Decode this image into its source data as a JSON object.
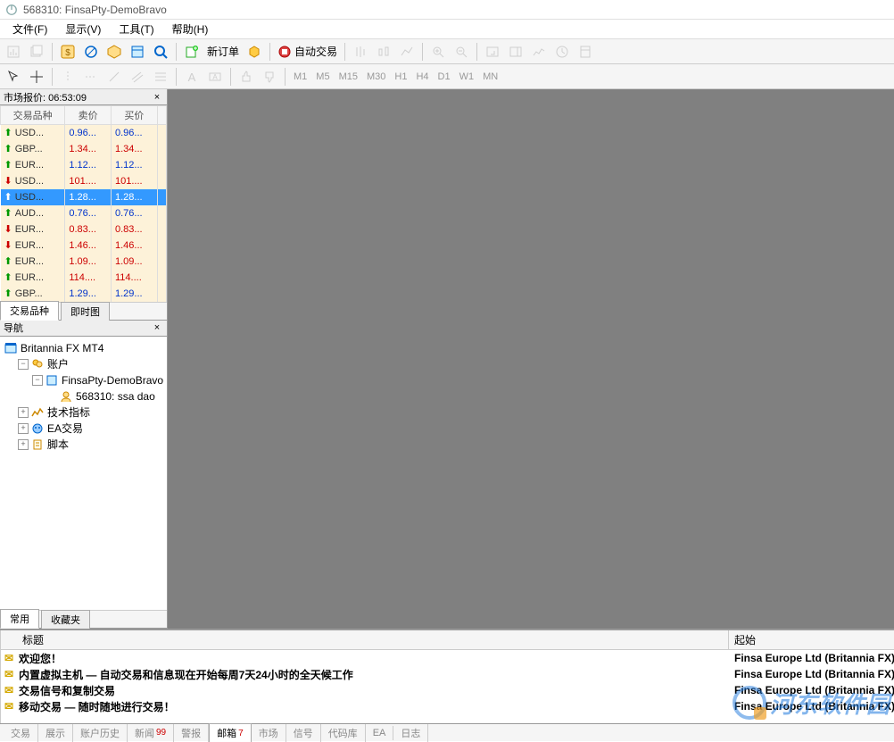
{
  "window": {
    "title": "568310: FinsaPty-DemoBravo"
  },
  "menu": {
    "file": "文件(F)",
    "view": "显示(V)",
    "tools": "工具(T)",
    "help": "帮助(H)"
  },
  "toolbar1": {
    "neworder": "新订单",
    "autotrade": "自动交易"
  },
  "toolbar2": {
    "tf": [
      "M1",
      "M5",
      "M15",
      "M30",
      "H1",
      "H4",
      "D1",
      "W1",
      "MN"
    ]
  },
  "market": {
    "title": "市场报价: 06:53:09",
    "cols": {
      "sym": "交易品种",
      "bid": "卖价",
      "ask": "买价"
    },
    "rows": [
      {
        "dir": "up",
        "sym": "USD...",
        "bid": "0.96...",
        "ask": "0.96...",
        "cls": "up"
      },
      {
        "dir": "up",
        "sym": "GBP...",
        "bid": "1.34...",
        "ask": "1.34...",
        "cls": "dn"
      },
      {
        "dir": "up",
        "sym": "EUR...",
        "bid": "1.12...",
        "ask": "1.12...",
        "cls": "up"
      },
      {
        "dir": "dn",
        "sym": "USD...",
        "bid": "101....",
        "ask": "101....",
        "cls": "dn"
      },
      {
        "dir": "up",
        "sym": "USD...",
        "bid": "1.28...",
        "ask": "1.28...",
        "cls": "up",
        "sel": true
      },
      {
        "dir": "up",
        "sym": "AUD...",
        "bid": "0.76...",
        "ask": "0.76...",
        "cls": "up"
      },
      {
        "dir": "dn",
        "sym": "EUR...",
        "bid": "0.83...",
        "ask": "0.83...",
        "cls": "dn"
      },
      {
        "dir": "dn",
        "sym": "EUR...",
        "bid": "1.46...",
        "ask": "1.46...",
        "cls": "dn"
      },
      {
        "dir": "up",
        "sym": "EUR...",
        "bid": "1.09...",
        "ask": "1.09...",
        "cls": "dn"
      },
      {
        "dir": "up",
        "sym": "EUR...",
        "bid": "114....",
        "ask": "114....",
        "cls": "dn"
      },
      {
        "dir": "up",
        "sym": "GBP...",
        "bid": "1.29...",
        "ask": "1.29...",
        "cls": "up"
      }
    ],
    "tabs": {
      "symbols": "交易品种",
      "tick": "即时图"
    }
  },
  "nav": {
    "title": "导航",
    "root": "Britannia FX MT4",
    "accounts": "账户",
    "server": "FinsaPty-DemoBravo",
    "login": "568310: ssa dao",
    "indicators": "技术指标",
    "ea": "EA交易",
    "scripts": "脚本",
    "tabs": {
      "common": "常用",
      "fav": "收藏夹"
    }
  },
  "mail": {
    "cols": {
      "subject": "标题",
      "from": "起始"
    },
    "rows": [
      {
        "subj": "欢迎您！",
        "from": "Finsa Europe Ltd (Britannia FX)"
      },
      {
        "subj": "内置虚拟主机 — 自动交易和信息现在开始每周7天24小时的全天候工作",
        "from": "Finsa Europe Ltd (Britannia FX)"
      },
      {
        "subj": "交易信号和复制交易",
        "from": "Finsa Europe Ltd (Britannia FX)"
      },
      {
        "subj": "移动交易 — 随时随地进行交易！",
        "from": "Finsa Europe Ltd (Britannia FX)"
      }
    ]
  },
  "btabs": {
    "trade": "交易",
    "exposure": "展示",
    "history": "账户历史",
    "news": "新闻",
    "alerts": "警报",
    "mailbox": "邮箱",
    "market": "市场",
    "signals": "信号",
    "code": "代码库",
    "ea": "EA",
    "journal": "日志",
    "news_badge": "99",
    "mail_badge": "7"
  },
  "watermark": "河东软件园"
}
